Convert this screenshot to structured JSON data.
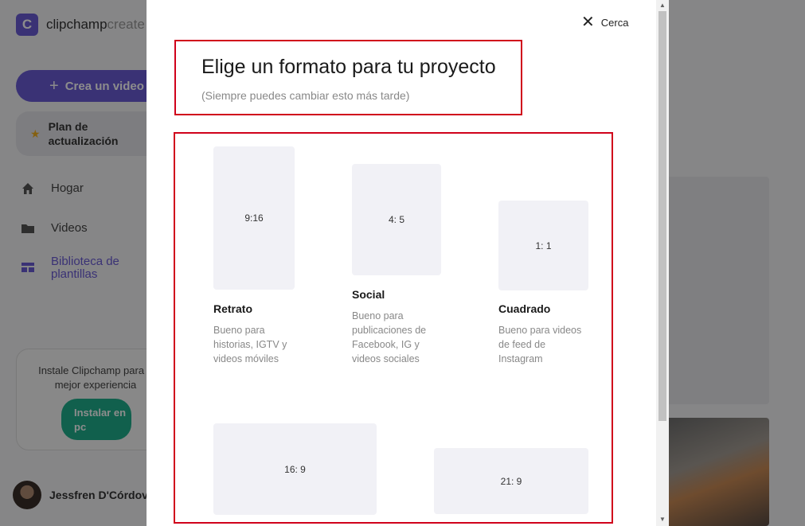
{
  "app": {
    "logo_text": "clipchamp",
    "logo_light": "create",
    "logo_letter": "C",
    "create_button": "Crea un video",
    "upgrade_button": "Plan de actualización",
    "nav": [
      {
        "label": "Hogar",
        "icon": "home-icon"
      },
      {
        "label": "Videos",
        "icon": "folder-icon"
      },
      {
        "label": "Biblioteca de plantillas",
        "icon": "templates-icon"
      }
    ],
    "install_card": {
      "text": "Instale Clipchamp para u mejor experiencia",
      "button": "Instalar en pc"
    },
    "user_name": "Jessfren D'Córdov"
  },
  "modal": {
    "close_label": "Cerca",
    "title": "Elige un formato para tu proyecto",
    "subtitle": "(Siempre puedes cambiar esto más tarde)",
    "formats": [
      {
        "ratio": "9:16",
        "name": "Retrato",
        "description": "Bueno para historias, IGTV y videos móviles"
      },
      {
        "ratio": "4: 5",
        "name": "Social",
        "description": "Bueno para publicaciones de Facebook, IG y videos sociales"
      },
      {
        "ratio": "1: 1",
        "name": "Cuadrado",
        "description": "Bueno para videos de feed de Instagram"
      },
      {
        "ratio": "16: 9",
        "name": "",
        "description": ""
      },
      {
        "ratio": "21: 9",
        "name": "",
        "description": ""
      }
    ]
  },
  "colors": {
    "brand": "#6b5bd6",
    "install": "#20b08c",
    "highlight_border": "#d0021b"
  }
}
